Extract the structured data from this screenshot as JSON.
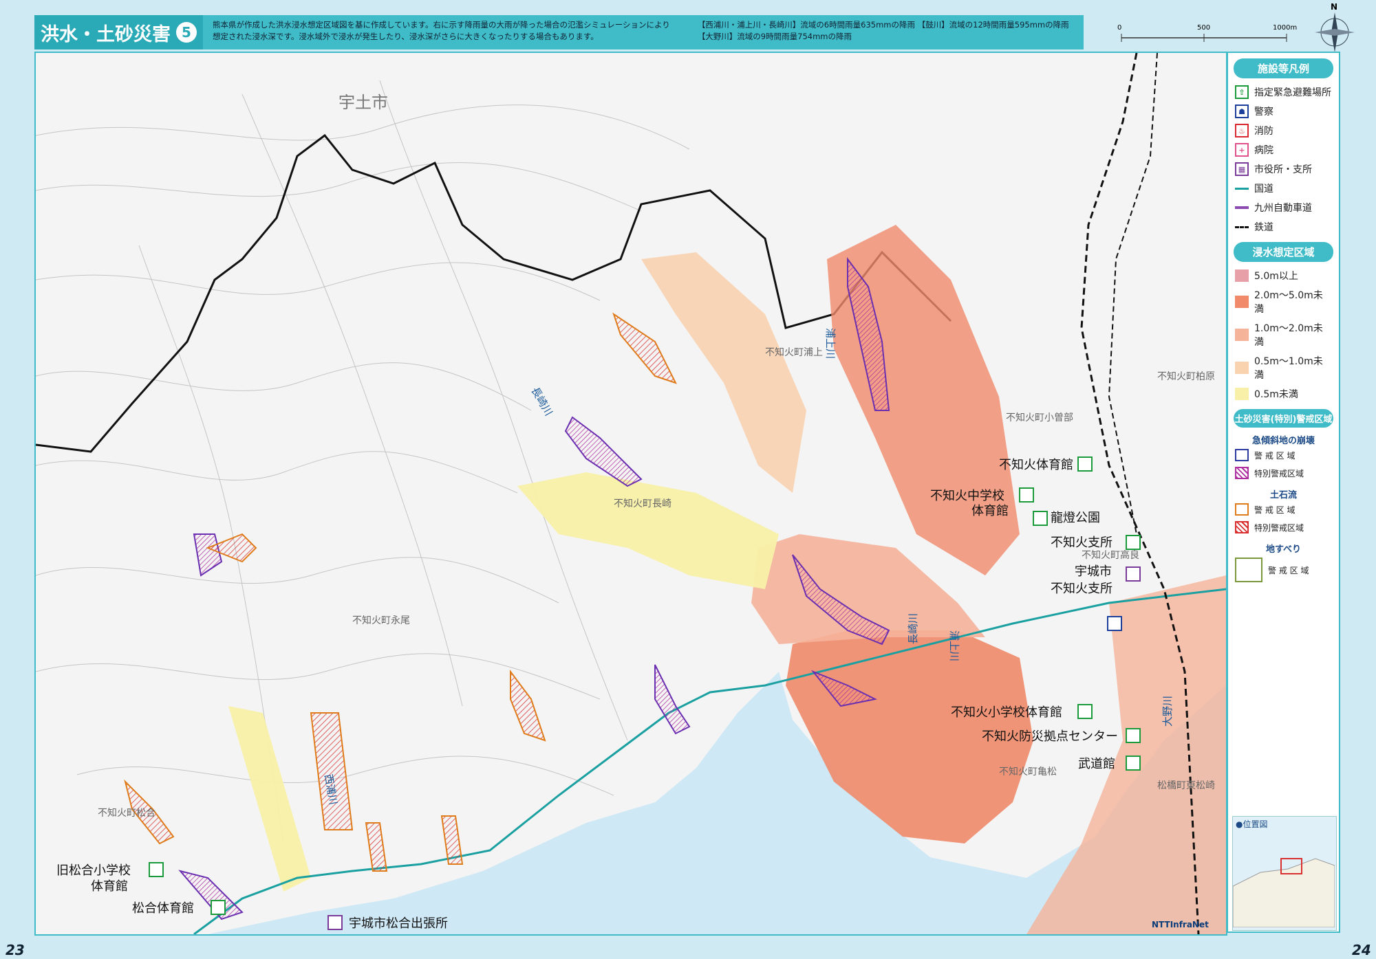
{
  "header": {
    "title": "洪水・土砂災害",
    "title_num": "5",
    "desc_left": "熊本県が作成した洪水浸水想定区域図を基に作成しています。右に示す降雨量の大雨が降った場合の氾濫シミュレーションにより\n想定された浸水深です。浸水域外で浸水が発生したり、浸水深がさらに大きくなったりする場合もあります。",
    "desc_right": "【西浦川・浦上川・長崎川】流域の6時間雨量635mmの降雨 【鼓川】流域の12時間雨量595mmの降雨\n【大野川】流域の9時間雨量754mmの降雨"
  },
  "scale": {
    "labels": [
      "0",
      "500",
      "1000m"
    ]
  },
  "compass": {
    "north": "N"
  },
  "map": {
    "places": [
      {
        "text": "宇土市"
      },
      {
        "text": "不知火町浦上"
      },
      {
        "text": "不知火町柏原"
      },
      {
        "text": "不知火町小曽部"
      },
      {
        "text": "不知火町長崎"
      },
      {
        "text": "不知火町高良"
      },
      {
        "text": "不知火町永尾"
      },
      {
        "text": "不知火町松合"
      },
      {
        "text": "不知火町亀松"
      },
      {
        "text": "松橋町東松崎"
      }
    ],
    "rivers": [
      "長崎川",
      "浦上川",
      "浦上川",
      "長崎川",
      "大野川",
      "西浦川"
    ],
    "facilities": [
      {
        "label": "不知火体育館",
        "type": "evac"
      },
      {
        "label": "不知火中学校",
        "type": "evac"
      },
      {
        "label": "体育館",
        "type": "none"
      },
      {
        "label": "龍燈公園",
        "type": "evac"
      },
      {
        "label": "不知火支所",
        "type": "evac"
      },
      {
        "label": "宇城市",
        "type": "none"
      },
      {
        "label": "不知火支所",
        "type": "office"
      },
      {
        "label": "不知火小学校体育館",
        "type": "evac"
      },
      {
        "label": "不知火防災拠点センター",
        "type": "evac"
      },
      {
        "label": "武道館",
        "type": "evac"
      },
      {
        "label": "旧松合小学校",
        "type": "evac"
      },
      {
        "label": "体育館",
        "type": "none"
      },
      {
        "label": "松合体育館",
        "type": "evac"
      },
      {
        "label": "宇城市松合出張所",
        "type": "office"
      }
    ]
  },
  "legend": {
    "facilities_title": "施設等凡例",
    "facilities": [
      {
        "label": "指定緊急避難場所",
        "icon": "evacuation-icon",
        "color": "#1a9a3a"
      },
      {
        "label": "警察",
        "icon": "police-icon",
        "color": "#1b3f9a"
      },
      {
        "label": "消防",
        "icon": "fire-icon",
        "color": "#d9282f"
      },
      {
        "label": "病院",
        "icon": "hospital-icon",
        "color": "#e0508a"
      },
      {
        "label": "市役所・支所",
        "icon": "city-office-icon",
        "color": "#7a3a9a"
      }
    ],
    "lines": [
      {
        "label": "国道",
        "color": "#1aa0a0"
      },
      {
        "label": "九州自動車道",
        "color": "#8a4ab0"
      },
      {
        "label": "鉄道",
        "color": "#111111"
      }
    ],
    "flood_title": "浸水想定区域",
    "flood": [
      {
        "label": "5.0m以上",
        "color": "#e8a0a8"
      },
      {
        "label": "2.0m～5.0m未満",
        "color": "#f08a6a"
      },
      {
        "label": "1.0m～2.0m未満",
        "color": "#f5b39a"
      },
      {
        "label": "0.5m～1.0m未満",
        "color": "#f9d2b0"
      },
      {
        "label": "0.5m未満",
        "color": "#f8f0a8"
      }
    ],
    "sediment_title": "土砂災害(特別)警戒区域",
    "steep_title": "急傾斜地の崩壊",
    "steep": [
      "警 戒 区 域",
      "特別警戒区域"
    ],
    "debris_title": "土石流",
    "debris": [
      "警 戒 区 域",
      "特別警戒区域"
    ],
    "landslide_title": "地すべり",
    "landslide": [
      "警 戒 区 域"
    ],
    "location_title": "●位置図"
  },
  "pages": {
    "left": "23",
    "right": "24"
  },
  "credit": "NTTInfraNet"
}
